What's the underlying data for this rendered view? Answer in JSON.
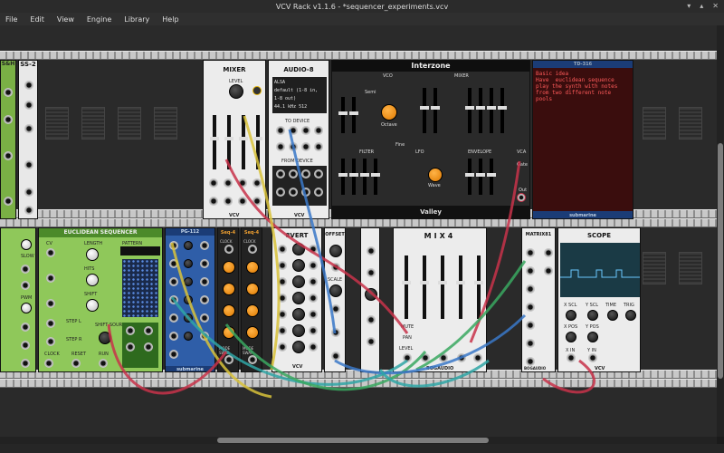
{
  "window": {
    "title": "VCV Rack v1.1.6 - *sequencer_experiments.vcv"
  },
  "menu": [
    "File",
    "Edit",
    "View",
    "Engine",
    "Library",
    "Help"
  ],
  "modules": {
    "ss2": {
      "title": "SS-2"
    },
    "sh": {
      "title": "S&H"
    },
    "mixer": {
      "title": "MIXER",
      "level": "LEVEL",
      "brand": "VCV"
    },
    "audio8": {
      "title": "AUDIO-8",
      "driver": "ALSA",
      "device": "default (1-8 in, 1-8 out)",
      "rate": "44.1 kHz",
      "block": "512",
      "to_device": "TO DEVICE",
      "from_device": "FROM DEVICE",
      "brand": "VCV"
    },
    "interzone": {
      "title": "Interzone",
      "vco": "VCO",
      "mixer": "MIXER",
      "filter": "FILTER",
      "lfo": "LFO",
      "envelope": "ENVELOPE",
      "vca": "VCA",
      "brand": "Valley",
      "labels": {
        "semi": "Semi",
        "fine": "Fine",
        "octave": "Octave",
        "wave": "Wave",
        "gate": "Gate",
        "out": "Out"
      }
    },
    "td316": {
      "title": "TD-316",
      "text": "Basic idea\nHave  euclidean sequence\nplay the synth with notes\nfrom two different note\npools",
      "brand": "submarine"
    },
    "euclid": {
      "title": "EUCLIDEAN SEQUENCER",
      "labels": [
        "LENGTH",
        "HITS",
        "SHIFT",
        "STEP L",
        "STEP R",
        "SHIFT SOURCE",
        "CLOCK",
        "RESET",
        "RUN",
        "PATTERN",
        "CV",
        "PWM",
        "SLOW"
      ]
    },
    "pg112": {
      "title": "PG-112",
      "brand": "submarine"
    },
    "seq4a": {
      "title": "Seq-4",
      "clock": "CLOCK",
      "reset": "RESET",
      "mode": "MODE SWAP",
      "out": "OUT"
    },
    "seq4b": {
      "title": "Seq-4",
      "clock": "CLOCK",
      "reset": "RESET",
      "mode": "MODE SWAP",
      "out": "OUT"
    },
    "8vert": {
      "title": "8VERT",
      "brand": "VCV"
    },
    "offset": {
      "title": "OFFSET",
      "scale": "SCALE"
    },
    "mix4": {
      "title": "MIX4",
      "brand": "BOGAUDIO",
      "labels": [
        "MUTE",
        "PAN",
        "LEVEL"
      ]
    },
    "matrix81": {
      "title": "MATRIX81",
      "brand": "BOGAUDIO"
    },
    "scope": {
      "title": "SCOPE",
      "labels": [
        "X SCL",
        "Y SCL",
        "TIME",
        "TRIG",
        "X POS",
        "Y POS",
        "X IN",
        "Y IN"
      ],
      "brand": "VCV"
    }
  },
  "colors": {
    "accent_orange": "#f0a030",
    "cable_red": "#c8324a",
    "cable_yellow": "#d8c23a",
    "cable_blue": "#3a78c8",
    "cable_green": "#3aa860",
    "cable_teal": "#2fa6a6"
  }
}
